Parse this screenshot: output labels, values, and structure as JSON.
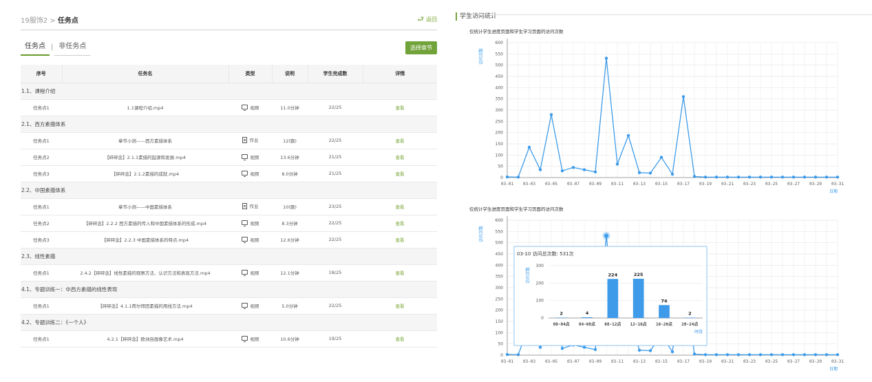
{
  "breadcrumb": {
    "course": "19服饰2",
    "separator": ">",
    "current": "任务点"
  },
  "back_label": "返回",
  "tabs": [
    {
      "label": "任务点"
    },
    {
      "label": "非任务点"
    }
  ],
  "tab_separator": "|",
  "select_chapter_label": "选择章节",
  "table": {
    "headers": [
      "序号",
      "任务名",
      "类型",
      "说明",
      "学生完成数",
      "详情"
    ],
    "view_label": "查看",
    "sections": [
      {
        "title": "1.1、课程介绍",
        "rows": [
          {
            "seq": "任务点1",
            "name": "1.1课程介绍.mp4",
            "type": "视频",
            "icon": "monitor-icon",
            "desc": "11.0分钟",
            "done": "22/25"
          }
        ]
      },
      {
        "title": "2.1、西方素描体系",
        "rows": [
          {
            "seq": "任务点1",
            "name": "章节小测——西方素描体系",
            "type": "作业",
            "icon": "document-icon",
            "desc": "12(题)",
            "done": "22/25"
          },
          {
            "seq": "任务点2",
            "name": "【碎碎念】2.1.1素描的起源和发展.mp4",
            "type": "视频",
            "icon": "monitor-icon",
            "desc": "13.6分钟",
            "done": "21/25"
          },
          {
            "seq": "任务点3",
            "name": "【碎碎念】2.1.2素描的成就.mp4",
            "type": "视频",
            "icon": "monitor-icon",
            "desc": "8.0分钟",
            "done": "21/25"
          }
        ]
      },
      {
        "title": "2.2、中国素描体系",
        "rows": [
          {
            "seq": "任务点1",
            "name": "章节小测——中国素描体系",
            "type": "作业",
            "icon": "document-icon",
            "desc": "10(题)",
            "done": "23/25"
          },
          {
            "seq": "任务点2",
            "name": "【碎碎念】2.2.2 西方素描的传入和中国素描体系的形成.mp4",
            "type": "视频",
            "icon": "monitor-icon",
            "desc": "8.3分钟",
            "done": "22/25"
          },
          {
            "seq": "任务点3",
            "name": "【碎碎念】2.2.3 中国素描体系的特点.mp4",
            "type": "视频",
            "icon": "monitor-icon",
            "desc": "12.6分钟",
            "done": "22/25"
          }
        ]
      },
      {
        "title": "2.3、线性素描",
        "rows": [
          {
            "seq": "任务点1",
            "name": "2.4.2【碎碎念】线性素描的观察方法、认识方法和表现方法.mp4",
            "type": "视频",
            "icon": "monitor-icon",
            "desc": "12.1分钟",
            "done": "18/25"
          }
        ]
      },
      {
        "title": "4.1、专题训练一：中西方素描的线性表现",
        "rows": [
          {
            "seq": "任务点1",
            "name": "【碎碎念】4.1.1荷尔拜因素描的用线方法.mp4",
            "type": "视频",
            "icon": "monitor-icon",
            "desc": "5.0分钟",
            "done": "22/25"
          }
        ]
      },
      {
        "title": "4.2、专题训练二：《一个人》",
        "rows": [
          {
            "seq": "任务点1",
            "name": "4.2.1【碎碎念】欧洲自画像艺术.mp4",
            "type": "视频",
            "icon": "monitor-icon",
            "desc": "10.6分钟",
            "done": "19/25"
          }
        ]
      }
    ]
  },
  "stats": {
    "title": "学生访问统计",
    "colors": {
      "accent": "#72a33a",
      "line": "#3d9be9",
      "axis": "#3d9be9"
    }
  },
  "chart_data": [
    {
      "type": "line",
      "title": "仅统计学生进度页面和学生学习页面的访问次数",
      "ylabel": "访问次数",
      "xlabel": "日期",
      "ylim": [
        0,
        600
      ],
      "yticks": [
        0,
        50,
        100,
        150,
        200,
        250,
        300,
        350,
        400,
        450,
        500,
        550,
        600
      ],
      "x": [
        "03-01",
        "03-02",
        "03-03",
        "03-04",
        "03-05",
        "03-06",
        "03-07",
        "03-08",
        "03-09",
        "03-10",
        "03-11",
        "03-12",
        "03-13",
        "03-14",
        "03-15",
        "03-16",
        "03-17",
        "03-18",
        "03-19",
        "03-20",
        "03-21",
        "03-22",
        "03-23",
        "03-24",
        "03-25",
        "03-26",
        "03-27",
        "03-28",
        "03-29",
        "03-30",
        "03-31"
      ],
      "xtick_labels": [
        "03-01",
        "03-03",
        "03-05",
        "03-07",
        "03-09",
        "03-11",
        "03-13",
        "03-15",
        "03-17",
        "03-19",
        "03-21",
        "03-23",
        "03-25",
        "03-27",
        "03-29",
        "03-31"
      ],
      "values": [
        3,
        2,
        135,
        35,
        280,
        30,
        45,
        35,
        25,
        531,
        60,
        187,
        22,
        20,
        90,
        15,
        360,
        5,
        2,
        2,
        2,
        2,
        2,
        2,
        2,
        2,
        2,
        2,
        2,
        2,
        2
      ]
    },
    {
      "type": "line",
      "title": "仅统计学生进度页面和学生学习页面的访问次数",
      "ylabel": "访问次数",
      "xlabel": "日期",
      "ylim": [
        0,
        600
      ],
      "yticks": [
        0,
        50,
        100,
        150,
        200,
        250,
        300,
        350,
        400,
        450,
        500,
        550,
        600
      ],
      "x": [
        "03-01",
        "03-02",
        "03-03",
        "03-04",
        "03-05",
        "03-06",
        "03-07",
        "03-08",
        "03-09",
        "03-10",
        "03-11",
        "03-12",
        "03-13",
        "03-14",
        "03-15",
        "03-16",
        "03-17",
        "03-18",
        "03-19",
        "03-20",
        "03-21",
        "03-22",
        "03-23",
        "03-24",
        "03-25",
        "03-26",
        "03-27",
        "03-28",
        "03-29",
        "03-30",
        "03-31"
      ],
      "xtick_labels": [
        "03-01",
        "03-03",
        "03-05",
        "03-07",
        "03-09",
        "03-11",
        "03-13",
        "03-15",
        "03-17",
        "03-19",
        "03-21",
        "03-23",
        "03-25",
        "03-27",
        "03-29",
        "03-31"
      ],
      "values": [
        3,
        2,
        135,
        35,
        280,
        30,
        45,
        35,
        25,
        531,
        60,
        187,
        22,
        20,
        90,
        15,
        360,
        5,
        2,
        2,
        2,
        2,
        2,
        2,
        2,
        2,
        2,
        2,
        2,
        2,
        2
      ],
      "highlight_index": 9,
      "tooltip": {
        "title": "03-10 访问总次数: 531次",
        "type": "bar",
        "ylabel": "访问次数",
        "xlabel": "时段",
        "ylim": [
          0,
          300
        ],
        "yticks": [
          0,
          100,
          200,
          300
        ],
        "categories": [
          "00-04点",
          "04-08点",
          "08-12点",
          "12-16点",
          "16-20点",
          "20-24点"
        ],
        "values": [
          2,
          4,
          224,
          225,
          74,
          2
        ]
      }
    }
  ]
}
